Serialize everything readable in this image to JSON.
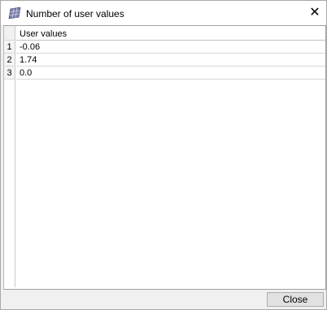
{
  "window": {
    "title": "Number of user values",
    "close_glyph": "✕"
  },
  "table": {
    "column_header": "User values",
    "rows": [
      {
        "num": "1",
        "value": "-0.06"
      },
      {
        "num": "2",
        "value": "1.74"
      },
      {
        "num": "3",
        "value": "0.0"
      }
    ]
  },
  "footer": {
    "close_label": "Close"
  }
}
